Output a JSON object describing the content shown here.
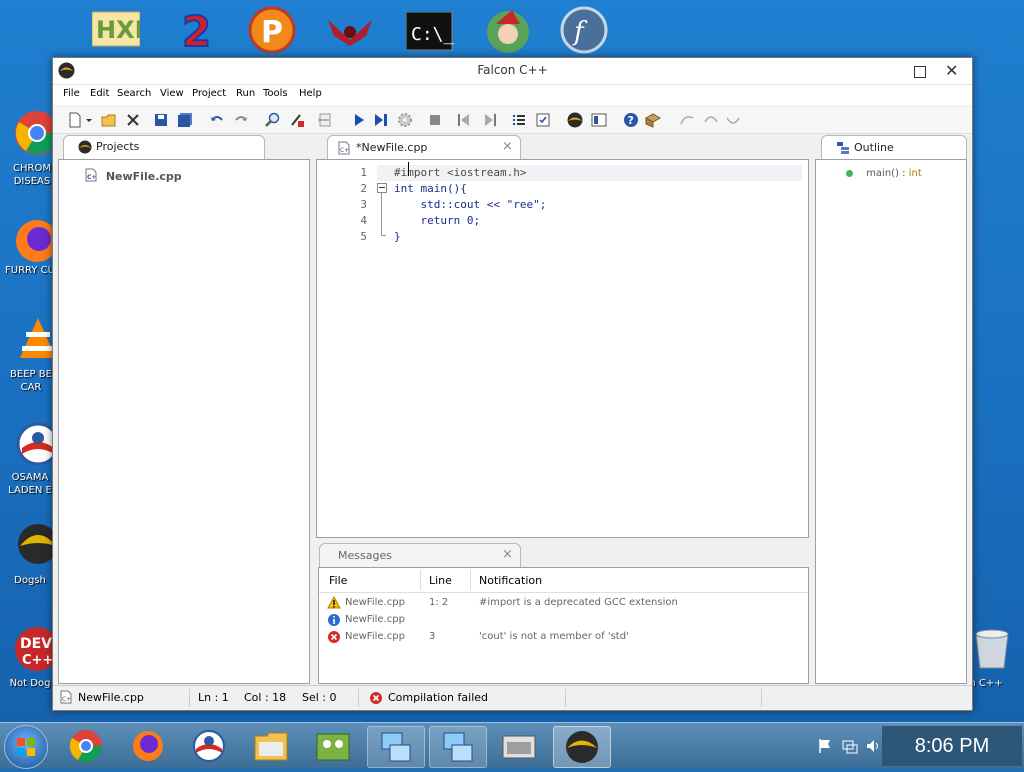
{
  "desktop": {
    "top_icons": [
      "hxd-icon",
      "2-icon",
      "p-icon",
      "winamp-icon",
      "cmd-icon",
      "santa-icon",
      "flash-icon"
    ],
    "left_icons": [
      {
        "label1": "CHROM",
        "label2": "DISEAS"
      },
      {
        "label1": "FURRY CU",
        "label2": ""
      },
      {
        "label1": "BEEP BE",
        "label2": "CAR"
      },
      {
        "label1": "OSAMA",
        "label2": "LADEN E"
      },
      {
        "label1": "Dogsh",
        "label2": ""
      },
      {
        "label1": "Not Dog",
        "label2": ""
      }
    ],
    "right_icon_label": "n C++"
  },
  "window": {
    "title": "Falcon C++"
  },
  "menu": [
    "File",
    "Edit",
    "Search",
    "View",
    "Project",
    "Run",
    "Tools",
    "Help"
  ],
  "projects_panel": {
    "tab_label": "Projects",
    "file": "NewFile.cpp"
  },
  "editor": {
    "tab_label": "*NewFile.cpp",
    "close_glyph": "×",
    "lines": [
      {
        "n": "1",
        "text": "#import <iostream.h>"
      },
      {
        "n": "2",
        "text": "int main(){"
      },
      {
        "n": "3",
        "text": "    std::cout << \"ree\";"
      },
      {
        "n": "4",
        "text": "    return 0;"
      },
      {
        "n": "5",
        "text": "}"
      }
    ]
  },
  "outline_panel": {
    "tab_label": "Outline",
    "item_name": "main()",
    "item_sep": ":",
    "item_type": "int"
  },
  "messages_panel": {
    "tab_label": "Messages",
    "close_glyph": "×",
    "columns": [
      "File",
      "Line",
      "Notification"
    ],
    "rows": [
      {
        "type": "warning",
        "file": "NewFile.cpp",
        "line": "1: 2",
        "note": "#import is a deprecated GCC extension"
      },
      {
        "type": "info",
        "file": "NewFile.cpp",
        "line": "",
        "note": ""
      },
      {
        "type": "error",
        "file": "NewFile.cpp",
        "line": "3",
        "note": "'cout' is not a member of 'std'"
      }
    ]
  },
  "statusbar": {
    "file": "NewFile.cpp",
    "ln": "Ln : 1",
    "col": "Col : 18",
    "sel": "Sel : 0",
    "status": "Compilation failed"
  },
  "taskbar": {
    "time": "8:06 PM"
  },
  "colors": {
    "error": "#d22b2b",
    "warning": "#f2c200",
    "info": "#2a6bd1"
  }
}
